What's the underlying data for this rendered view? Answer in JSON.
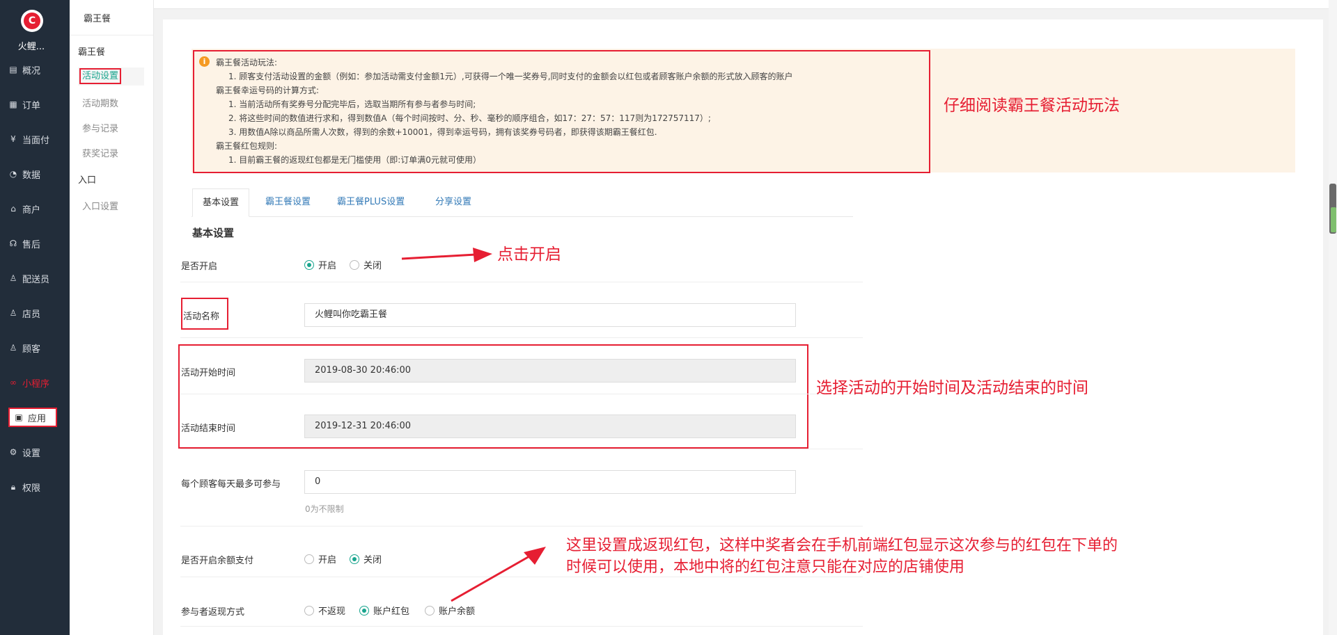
{
  "nav": {
    "brand": "火鲤...",
    "logo_icon": "logo-icon",
    "items": [
      {
        "label": "概况",
        "icon": "overview-icon"
      },
      {
        "label": "订单",
        "icon": "order-icon"
      },
      {
        "label": "当面付",
        "icon": "yuan-icon"
      },
      {
        "label": "数据",
        "icon": "chart-icon"
      },
      {
        "label": "商户",
        "icon": "shop-icon"
      },
      {
        "label": "售后",
        "icon": "headset-icon"
      },
      {
        "label": "配送员",
        "icon": "courier-icon"
      },
      {
        "label": "店员",
        "icon": "staff-icon"
      },
      {
        "label": "顾客",
        "icon": "customer-icon"
      },
      {
        "label": "小程序",
        "icon": "miniprogram-icon"
      },
      {
        "label": "应用",
        "icon": "apps-icon"
      },
      {
        "label": "设置",
        "icon": "gear-icon"
      },
      {
        "label": "权限",
        "icon": "lock-icon"
      }
    ]
  },
  "subnav": {
    "title": "霸王餐",
    "group1": "霸王餐",
    "items1": [
      "活动设置",
      "活动期数",
      "参与记录",
      "获奖记录"
    ],
    "group2": "入口",
    "items2": [
      "入口设置"
    ]
  },
  "info": {
    "lines": [
      "霸王餐活动玩法:",
      "1. 顾客支付活动设置的金额（例如：参加活动需支付金额1元）,可获得一个唯一奖券号,同时支付的金额会以红包或者顾客账户余额的形式放入顾客的账户",
      "霸王餐幸运号码的计算方式:",
      "1. 当前活动所有奖券号分配完毕后，选取当期所有参与者参与时间;",
      "2. 将这些时间的数值进行求和，得到数值A（每个时间按时、分、秒、毫秒的顺序组合，如17：27：57：117则为172757117）;",
      "3. 用数值A除以商品所需人次数，得到的余数+10001，得到幸运号码，拥有该奖券号码者，即获得该期霸王餐红包.",
      "霸王餐红包规则:",
      "1. 目前霸王餐的返现红包都是无门槛使用（即:订单满0元就可使用）"
    ]
  },
  "annotations": {
    "read_rules": "仔细阅读霸王餐活动玩法",
    "click_open": "点击开启",
    "choose_time": "选择活动的开始时间及活动结束的时间",
    "redpacket_note_1": "这里设置成返现红包，这样中奖者会在手机前端红包显示这次参与的红包在下单的",
    "redpacket_note_2": "时候可以使用，本地中将的红包注意只能在对应的店铺使用"
  },
  "tabs": [
    "基本设置",
    "霸王餐设置",
    "霸王餐PLUS设置",
    "分享设置"
  ],
  "section_title": "基本设置",
  "form": {
    "enabled": {
      "label": "是否开启",
      "options": [
        "开启",
        "关闭"
      ],
      "selected": "开启"
    },
    "name": {
      "label": "活动名称",
      "value": "火鲤叫你吃霸王餐"
    },
    "start": {
      "label": "活动开始时间",
      "value": "2019-08-30 20:46:00"
    },
    "end": {
      "label": "活动结束时间",
      "value": "2019-12-31 20:46:00"
    },
    "daily_limit": {
      "label": "每个顾客每天最多可参与",
      "value": "0",
      "hint": "0为不限制"
    },
    "balance_pay": {
      "label": "是否开启余额支付",
      "options": [
        "开启",
        "关闭"
      ],
      "selected": "关闭"
    },
    "cashback": {
      "label": "参与者返现方式",
      "options": [
        "不返现",
        "账户红包",
        "账户余额"
      ],
      "selected": "账户红包"
    }
  },
  "colors": {
    "accent": "#19a58e",
    "annotation": "#e61e32",
    "nav_bg": "#222d3a",
    "info_bg": "#fdf3e6"
  }
}
